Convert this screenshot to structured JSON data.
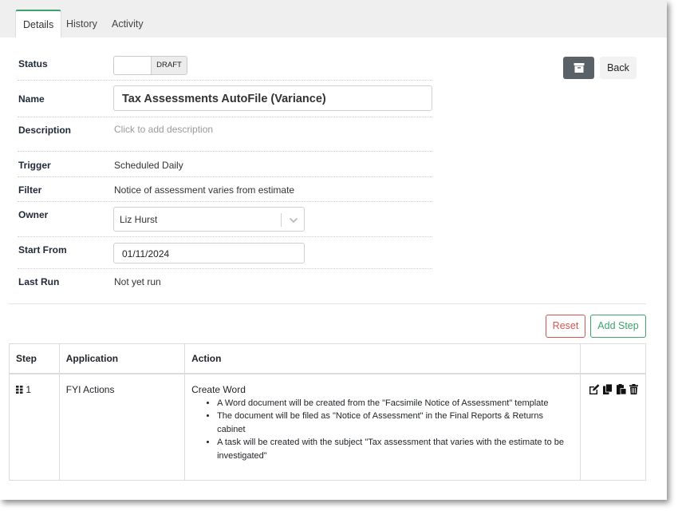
{
  "tabs": [
    {
      "label": "Details"
    },
    {
      "label": "History"
    },
    {
      "label": "Activity"
    }
  ],
  "fields": {
    "status_label": "Status",
    "status_value": "DRAFT",
    "name_label": "Name",
    "name_value": "Tax Assessments AutoFile (Variance)",
    "description_label": "Description",
    "description_placeholder": "Click to add description",
    "trigger_label": "Trigger",
    "trigger_value": "Scheduled Daily",
    "filter_label": "Filter",
    "filter_value": "Notice of assessment varies from estimate",
    "owner_label": "Owner",
    "owner_value": "Liz Hurst",
    "start_label": "Start From",
    "start_value": "01/11/2024",
    "lastrun_label": "Last Run",
    "lastrun_value": "Not yet run"
  },
  "header_actions": {
    "archive_icon": "archive-box-icon",
    "back_label": "Back"
  },
  "step_actions": {
    "reset_label": "Reset",
    "add_step_label": "Add Step"
  },
  "table": {
    "columns": [
      "Step",
      "Application",
      "Action",
      ""
    ],
    "rows": [
      {
        "step": "1",
        "application": "FYI Actions",
        "action_title": "Create Word",
        "action_details": [
          "A Word document will be created from the \"Facsimile Notice of Assessment\" template",
          "The document will be filed as \"Notice of Assessment\" in the Final Reports & Returns cabinet",
          "A task will be created with the subject \"Tax assessment that varies with the estimate to be investigated\""
        ],
        "row_icons": [
          "edit-icon",
          "copy-icon",
          "paste-icon",
          "trash-icon"
        ]
      }
    ]
  },
  "colors": {
    "accent_green": "#3ea36b",
    "danger_red": "#d9534f",
    "archive_button": "#5a6268"
  }
}
